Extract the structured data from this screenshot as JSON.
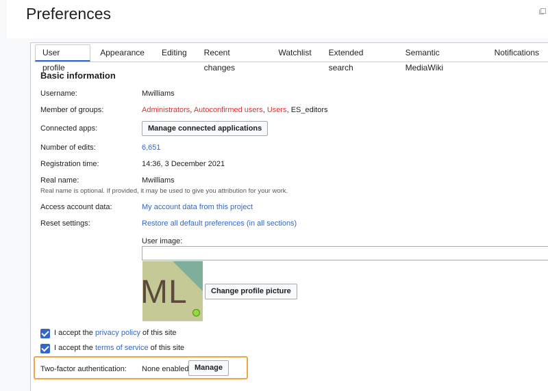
{
  "page": {
    "title": "Preferences"
  },
  "tabs": [
    "User profile",
    "Appearance",
    "Editing",
    "Recent changes",
    "Watchlist",
    "Extended search",
    "Semantic MediaWiki",
    "Notifications"
  ],
  "section": {
    "basic_information": "Basic information"
  },
  "fields": {
    "username_label": "Username:",
    "username_value": "Mwilliams",
    "groups_label": "Member of groups:",
    "group_admins": "Administrators",
    "group_autoconfirmed": "Autoconfirmed users",
    "group_users": "Users",
    "group_es_editors": "ES_editors",
    "sep_comma": ",",
    "connected_apps_label": "Connected apps:",
    "connected_apps_button": "Manage connected applications",
    "edits_label": "Number of edits:",
    "edits_value": "6,651",
    "registration_label": "Registration time:",
    "registration_value": "14:36, 3 December 2021",
    "realname_label": "Real name:",
    "realname_value": "Mwilliams",
    "realname_hint": "Real name is optional. If provided, it may be used to give you attribution for your work.",
    "access_label": "Access account data:",
    "access_link": "My account data from this project",
    "reset_label": "Reset settings:",
    "reset_link": "Restore all default preferences (in all sections)",
    "user_image_label": "User image:",
    "avatar_initials": "ML",
    "change_picture_button": "Change profile picture"
  },
  "checkboxes": {
    "privacy_prefix": "I accept the",
    "privacy_link": "privacy policy",
    "privacy_suffix": "of this site",
    "terms_prefix": "I accept the",
    "terms_link": "terms of service",
    "terms_suffix": "of this site"
  },
  "twofa": {
    "label": "Two-factor authentication:",
    "value": "None enabled",
    "button": "Manage"
  },
  "colors": {
    "accent": "#3366cc",
    "red_link": "#d33",
    "highlight": "#f3a546"
  }
}
